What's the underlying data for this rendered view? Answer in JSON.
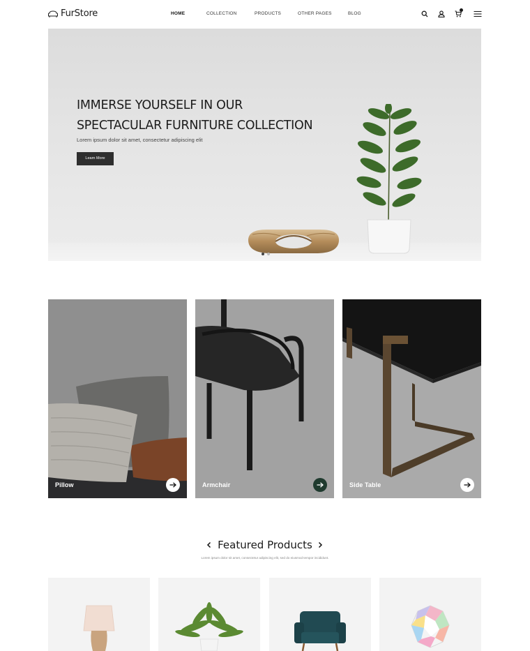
{
  "brand": {
    "name": "FurStore"
  },
  "nav": {
    "items": [
      {
        "label": "HOME",
        "active": true
      },
      {
        "label": "COLLECTION",
        "active": false
      },
      {
        "label": "PRODUCTS",
        "active": false
      },
      {
        "label": "OTHER PAGES",
        "active": false
      },
      {
        "label": "BLOG",
        "active": false
      }
    ]
  },
  "header_icons": [
    "search-icon",
    "user-icon",
    "cart-icon",
    "menu-icon"
  ],
  "hero": {
    "title_line1": "IMMERSE YOURSELF IN OUR",
    "title_line2": "SPECTACULAR FURNITURE COLLECTION",
    "subtitle": "Lorem ipsum dolor sit amet, consectetur adipiscing elit",
    "button_label": "Learn More",
    "slides": 2,
    "active_slide": 1
  },
  "categories": [
    {
      "label": "Pillow",
      "arrow_style": "light"
    },
    {
      "label": "Armchair",
      "arrow_style": "dark"
    },
    {
      "label": "Side Table",
      "arrow_style": "light"
    }
  ],
  "featured": {
    "title": "Featured Products",
    "subtitle": "Lorem ipsum dolor sit amet, consectetur adipiscing elit, sed do eiusmod tempor incididunt.",
    "products": [
      "table-lamp",
      "potted-plant",
      "teal-armchair",
      "patchwork-pouf"
    ]
  },
  "colors": {
    "accent_dark": "#1f3a2e",
    "button": "#2e2e2e",
    "text": "#1a1a1a"
  }
}
